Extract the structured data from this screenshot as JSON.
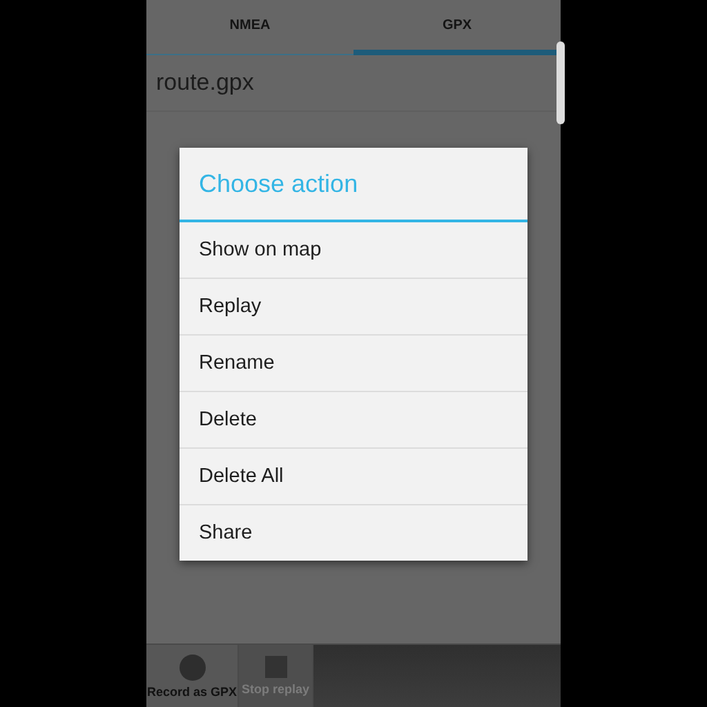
{
  "tabs": [
    {
      "label": "NMEA",
      "selected": false
    },
    {
      "label": "GPX",
      "selected": true
    }
  ],
  "files": [
    "route.gpx"
  ],
  "dialog": {
    "title": "Choose action",
    "items": [
      "Show on map",
      "Replay",
      "Rename",
      "Delete",
      "Delete All",
      "Share"
    ]
  },
  "toolbar": [
    {
      "kind": "record",
      "label": "Record as GPX",
      "disabled": false
    },
    {
      "kind": "stop",
      "label": "Stop replay",
      "disabled": true
    }
  ]
}
